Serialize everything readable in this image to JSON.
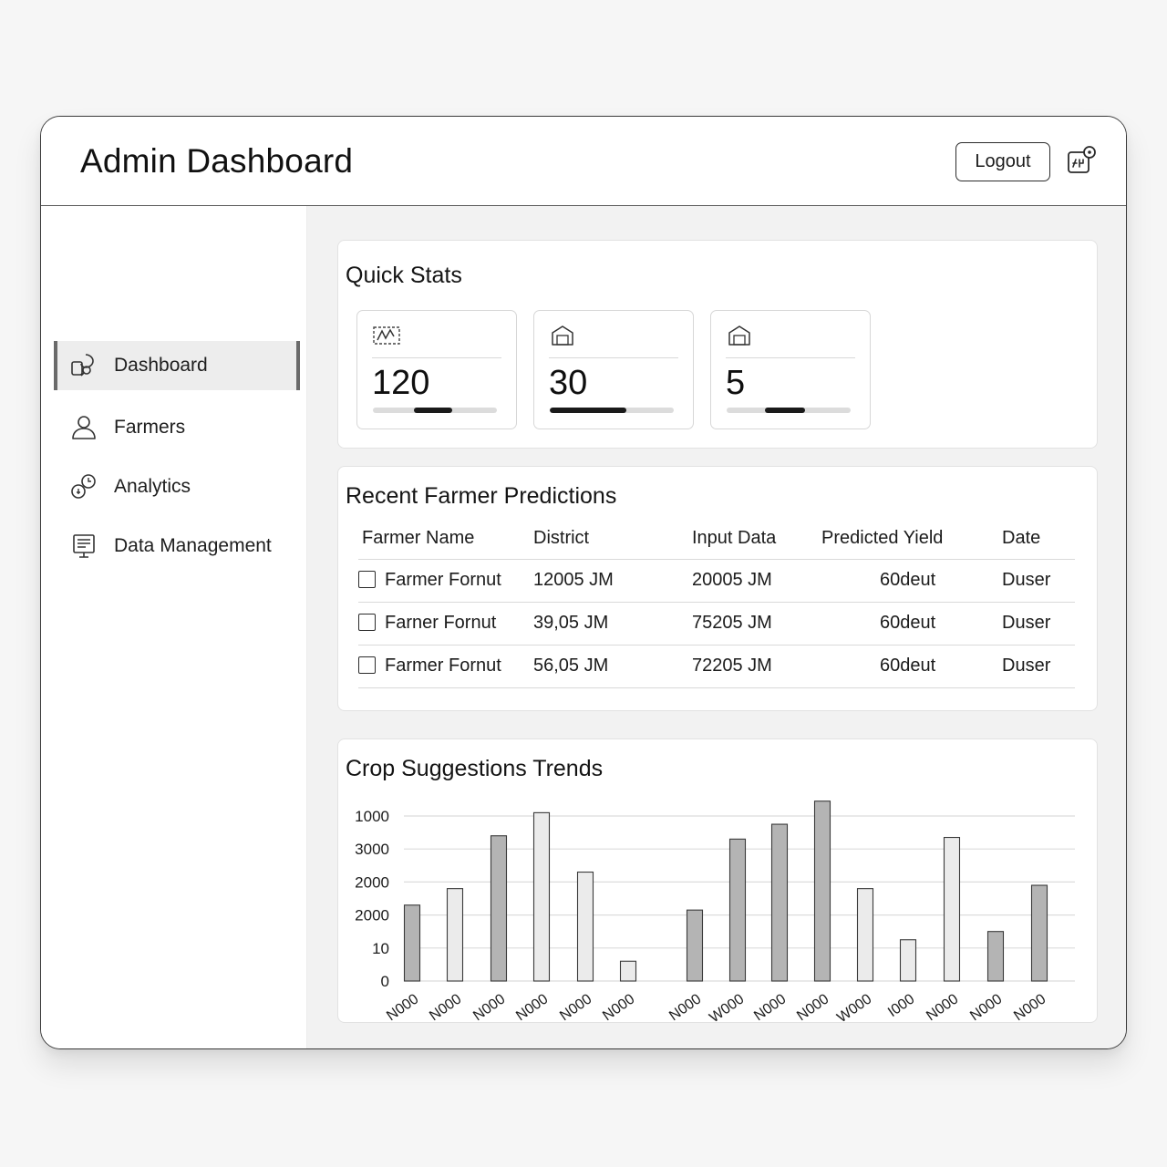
{
  "header": {
    "title": "Admin Dashboard",
    "logout_label": "Logout",
    "user_icon": "user-settings-icon"
  },
  "sidebar": {
    "items": [
      {
        "label": "Dashboard",
        "icon": "dashboard-icon",
        "active": true
      },
      {
        "label": "Farmers",
        "icon": "person-icon",
        "active": false
      },
      {
        "label": "Analytics",
        "icon": "analytics-icon",
        "active": false
      },
      {
        "label": "Data Management",
        "icon": "data-management-icon",
        "active": false
      }
    ]
  },
  "quick_stats": {
    "title": "Quick Stats",
    "cards": [
      {
        "value": "120",
        "icon": "stats-icon",
        "progress_start": 0.33,
        "progress_end": 0.64
      },
      {
        "value": "30",
        "icon": "box-icon",
        "progress_start": 0.0,
        "progress_end": 0.62
      },
      {
        "value": "5",
        "icon": "box-icon",
        "progress_start": 0.31,
        "progress_end": 0.63
      }
    ]
  },
  "predictions": {
    "title": "Recent Farmer Predictions",
    "columns": [
      "Farmer Name",
      "District",
      "Input Data",
      "Predicted Yield",
      "Date"
    ],
    "rows": [
      [
        "Farmer Fornut",
        "12005 JM",
        "20005 JM",
        "60deut",
        "Duser"
      ],
      [
        "Farner Fornut",
        "39,05 JM",
        "75205 JM",
        "60deut",
        "Duser"
      ],
      [
        "Farmer Fornut",
        "56,05 JM",
        "72205 JM",
        "60deut",
        "Duser"
      ]
    ]
  },
  "chart_data": {
    "type": "bar",
    "title": "Crop Suggestions Trends",
    "y_tick_labels": [
      "1000",
      "3000",
      "2000",
      "2000",
      "10",
      "0"
    ],
    "categories": [
      "N000",
      "N000",
      "N000",
      "N000",
      "N000",
      "N000",
      "N000",
      "W000",
      "N000",
      "N000",
      "W000",
      "I000",
      "N000",
      "N000",
      "N000"
    ],
    "values": [
      2.3,
      2.8,
      4.4,
      5.1,
      3.3,
      0.6,
      2.15,
      4.3,
      4.75,
      5.45,
      2.8,
      1.25,
      4.35,
      1.5,
      2.9
    ],
    "bar_colors": [
      "#b4b4b4",
      "#ebebeb",
      "#b4b4b4",
      "#ebebeb",
      "#ebebeb",
      "#ebebeb",
      "#b4b4b4",
      "#b4b4b4",
      "#b4b4b4",
      "#b4b4b4",
      "#ebebeb",
      "#ebebeb",
      "#ebebeb",
      "#b4b4b4",
      "#b4b4b4"
    ],
    "ylim": [
      0,
      5
    ],
    "grid": true,
    "xlabel": "",
    "ylabel": ""
  }
}
